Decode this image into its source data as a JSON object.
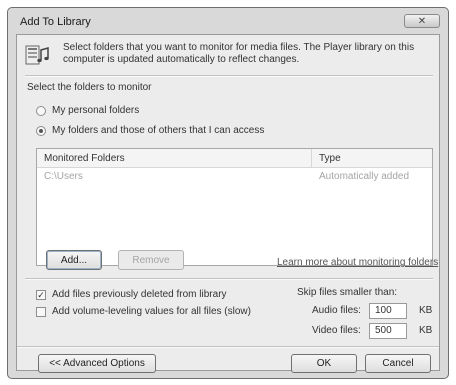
{
  "window": {
    "title": "Add To Library",
    "close_glyph": "✕"
  },
  "intro": {
    "icon": "library-music-icon",
    "text": "Select folders that you want to monitor for media files. The Player library on this computer is updated automatically to reflect changes."
  },
  "folders_section": {
    "label": "Select the folders to monitor",
    "options": [
      {
        "label": "My personal folders",
        "selected": false
      },
      {
        "label": "My folders and those of others that I can access",
        "selected": true
      }
    ]
  },
  "folder_list": {
    "columns": [
      "Monitored Folders",
      "Type"
    ],
    "rows": [
      {
        "folder": "C:\\Users",
        "type": "Automatically added"
      }
    ]
  },
  "list_buttons": {
    "add": "Add...",
    "remove": "Remove"
  },
  "learn_more_link": "Learn more about monitoring folders",
  "options": {
    "add_deleted": {
      "label": "Add files previously deleted from library",
      "checked": true
    },
    "volume_leveling": {
      "label": "Add volume-leveling values for all files (slow)",
      "checked": false
    }
  },
  "skip": {
    "label": "Skip files smaller than:",
    "audio_label": "Audio files:",
    "audio_value": "100",
    "audio_unit": "KB",
    "video_label": "Video files:",
    "video_value": "500",
    "video_unit": "KB"
  },
  "footer": {
    "advanced": "<< Advanced Options",
    "ok": "OK",
    "cancel": "Cancel"
  }
}
